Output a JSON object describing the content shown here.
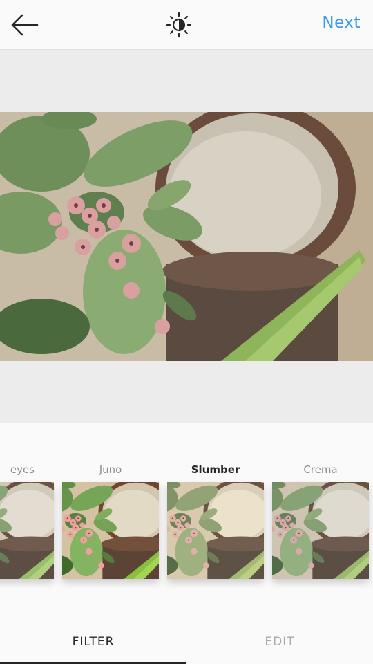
{
  "header": {
    "back_icon": "arrow-left-icon",
    "lux_icon": "brightness-icon",
    "next_label": "Next",
    "accent_color": "#3897f0"
  },
  "photo": {
    "subject": ""
  },
  "filters": [
    {
      "label": "eyes",
      "selected": false
    },
    {
      "label": "Juno",
      "selected": false
    },
    {
      "label": "Slumber",
      "selected": true
    },
    {
      "label": "Crema",
      "selected": false
    }
  ],
  "tabs": {
    "filter_label": "FILTER",
    "edit_label": "EDIT",
    "active": "FILTER"
  }
}
